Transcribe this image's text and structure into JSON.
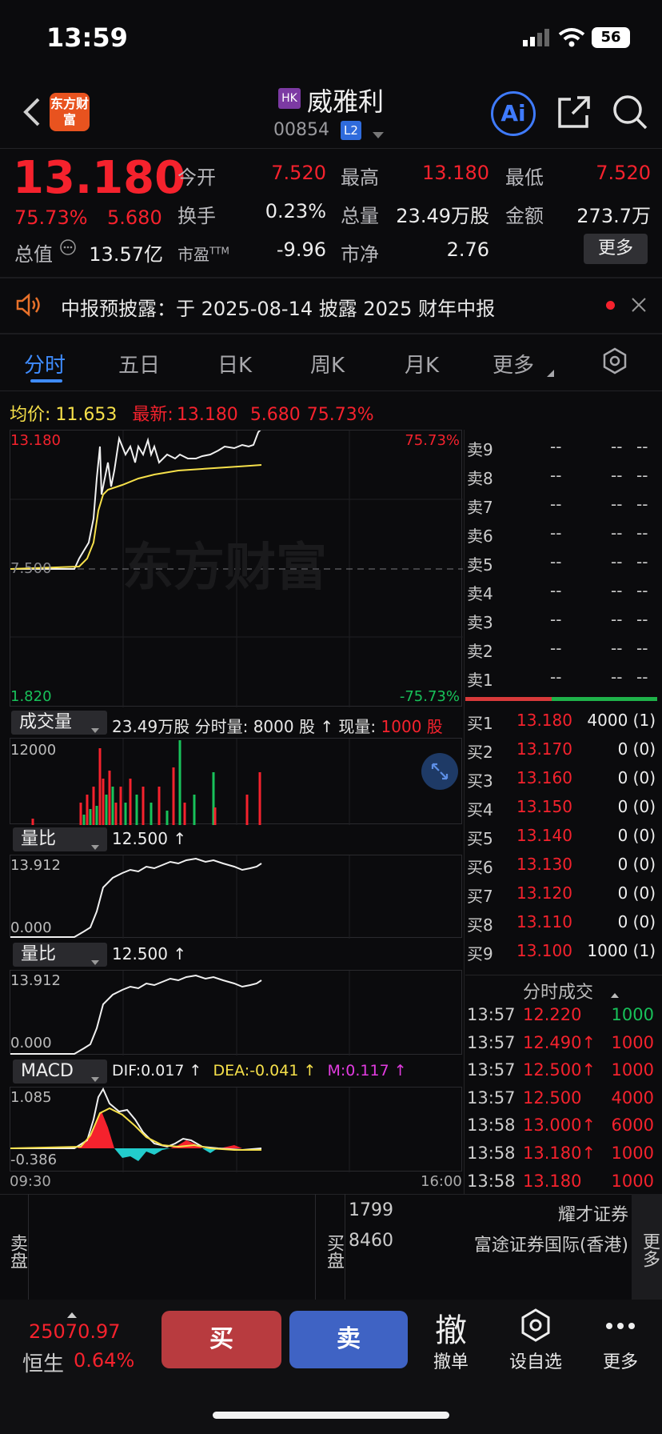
{
  "status": {
    "time": "13:59",
    "battery": "56"
  },
  "header": {
    "logo": "东方财富",
    "market": "HK",
    "name": "威雅利",
    "code": "00854",
    "level": "L2",
    "ai": "Ai"
  },
  "quote": {
    "price": "13.180",
    "change_pct": "75.73%",
    "change": "5.680",
    "open_label": "今开",
    "open": "7.520",
    "high_label": "最高",
    "high": "13.180",
    "low_label": "最低",
    "low": "7.520",
    "turnover_label": "换手",
    "turnover": "0.23%",
    "volume_label": "总量",
    "volume": "23.49万股",
    "amount_label": "金额",
    "amount": "273.7万",
    "mktcap_label": "总值",
    "mktcap": "13.57亿",
    "pe_label": "市盈",
    "pe_sup": "TTM",
    "pe": "-9.96",
    "pb_label": "市净",
    "pb": "2.76",
    "more": "更多"
  },
  "notice": {
    "text": "中报预披露：于 2025-08-14 披露 2025 财年中报"
  },
  "tabs": [
    {
      "label": "分时"
    },
    {
      "label": "五日"
    },
    {
      "label": "日K"
    },
    {
      "label": "周K"
    },
    {
      "label": "月K"
    },
    {
      "label": "更多"
    }
  ],
  "intraday": {
    "avg_label": "均价:",
    "avg": "11.653",
    "latest_label": "最新:",
    "latest": "13.180",
    "latest_chg": "5.680",
    "latest_pct": "75.73%",
    "y_top": "13.180",
    "y_mid": "7.500",
    "y_bot": "1.820",
    "pct_top": "75.73%",
    "pct_bot": "-75.73%",
    "watermark": "东方财富"
  },
  "volume_panel": {
    "selector": "成交量",
    "info": "23.49万股 分时量: 8000 股 ↑ 现量:",
    "now": "1000 股",
    "y_top": "12000"
  },
  "ratio_panel_1": {
    "selector": "量比",
    "value": "12.500 ↑",
    "y_top": "13.912",
    "y_bot": "0.000"
  },
  "ratio_panel_2": {
    "selector": "量比",
    "value": "12.500 ↑",
    "y_top": "13.912",
    "y_bot": "0.000"
  },
  "macd_panel": {
    "selector": "MACD",
    "dif": "DIF:0.017 ↑",
    "dea": "DEA:-0.041 ↑",
    "m": "M:0.117 ↑",
    "y_top": "1.085",
    "y_bot": "-0.386",
    "x_start": "09:30",
    "x_end": "16:00"
  },
  "sell_book": [
    {
      "label": "卖9",
      "price": "--",
      "vol": "--",
      "cnt": "--"
    },
    {
      "label": "卖8",
      "price": "--",
      "vol": "--",
      "cnt": "--"
    },
    {
      "label": "卖7",
      "price": "--",
      "vol": "--",
      "cnt": "--"
    },
    {
      "label": "卖6",
      "price": "--",
      "vol": "--",
      "cnt": "--"
    },
    {
      "label": "卖5",
      "price": "--",
      "vol": "--",
      "cnt": "--"
    },
    {
      "label": "卖4",
      "price": "--",
      "vol": "--",
      "cnt": "--"
    },
    {
      "label": "卖3",
      "price": "--",
      "vol": "--",
      "cnt": "--"
    },
    {
      "label": "卖2",
      "price": "--",
      "vol": "--",
      "cnt": "--"
    },
    {
      "label": "卖1",
      "price": "--",
      "vol": "--",
      "cnt": "--"
    }
  ],
  "buy_book": [
    {
      "label": "买1",
      "price": "13.180",
      "vol": "4000 (1)"
    },
    {
      "label": "买2",
      "price": "13.170",
      "vol": "0 (0)"
    },
    {
      "label": "买3",
      "price": "13.160",
      "vol": "0 (0)"
    },
    {
      "label": "买4",
      "price": "13.150",
      "vol": "0 (0)"
    },
    {
      "label": "买5",
      "price": "13.140",
      "vol": "0 (0)"
    },
    {
      "label": "买6",
      "price": "13.130",
      "vol": "0 (0)"
    },
    {
      "label": "买7",
      "price": "13.120",
      "vol": "0 (0)"
    },
    {
      "label": "买8",
      "price": "13.110",
      "vol": "0 (0)"
    },
    {
      "label": "买9",
      "price": "13.100",
      "vol": "1000 (1)"
    }
  ],
  "trades_title": "分时成交",
  "trades": [
    {
      "time": "13:57",
      "price": "12.220",
      "vol": "1000",
      "color": "green"
    },
    {
      "time": "13:57",
      "price": "12.490↑",
      "vol": "1000",
      "color": "red"
    },
    {
      "time": "13:57",
      "price": "12.500↑",
      "vol": "1000",
      "color": "red"
    },
    {
      "time": "13:57",
      "price": "12.500",
      "vol": "4000",
      "color": "red"
    },
    {
      "time": "13:58",
      "price": "13.000↑",
      "vol": "6000",
      "color": "red"
    },
    {
      "time": "13:58",
      "price": "13.180↑",
      "vol": "1000",
      "color": "red"
    },
    {
      "time": "13:58",
      "price": "13.180",
      "vol": "1000",
      "color": "red"
    }
  ],
  "brokers": {
    "sell_label": "卖盘",
    "buy_label": "买盘",
    "more": "更多",
    "rows": [
      {
        "id": "1799",
        "name": "耀才证券"
      },
      {
        "id": "8460",
        "name": "富途证券国际(香港)"
      }
    ]
  },
  "bottom": {
    "index_value": "25070.97",
    "index_name": "恒生",
    "index_pct": "0.64%",
    "buy": "买",
    "sell": "卖",
    "cancel_icon": "撤",
    "cancel": "撤单",
    "watch": "设自选",
    "more": "更多"
  }
}
